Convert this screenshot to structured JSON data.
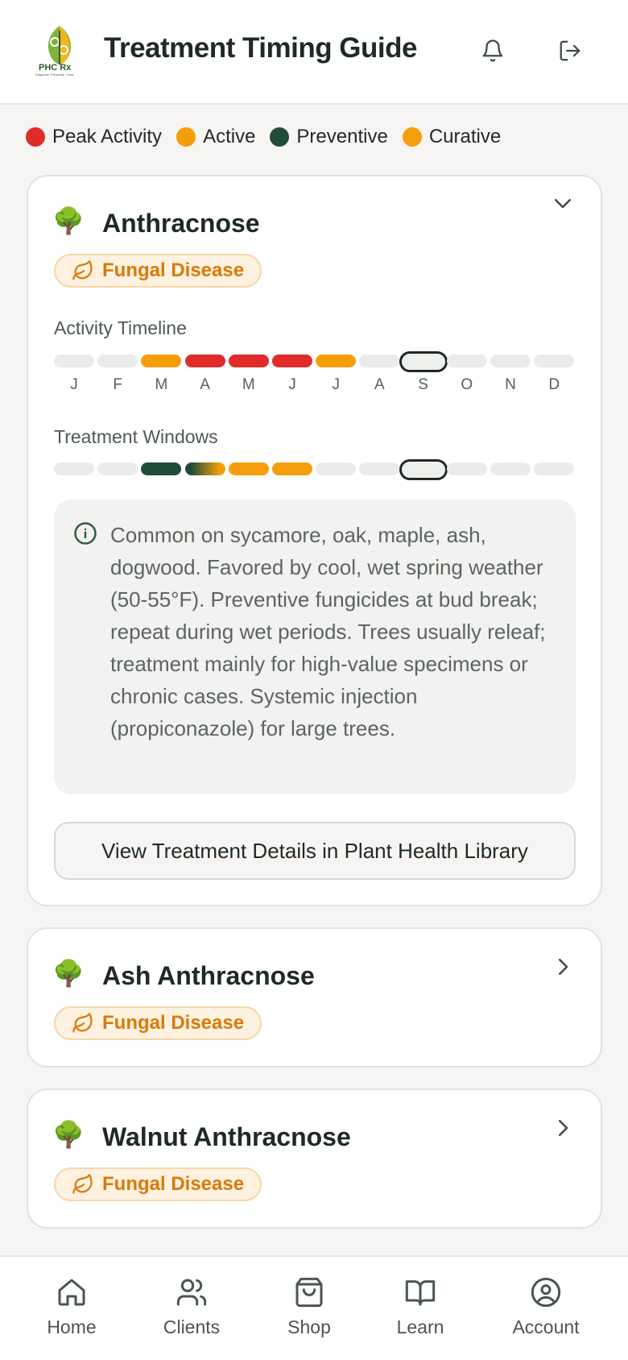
{
  "header": {
    "title": "Treatment Timing Guide",
    "logo_text": "PHC Rx",
    "logo_tagline": "Diagnose. Prescribe. Treat."
  },
  "legend": [
    {
      "label": "Peak Activity",
      "color": "#e02b2b"
    },
    {
      "label": "Active",
      "color": "#f59e0b"
    },
    {
      "label": "Preventive",
      "color": "#1f4d3a"
    },
    {
      "label": "Curative",
      "color": "#f59e0b"
    }
  ],
  "months": [
    "J",
    "F",
    "M",
    "A",
    "M",
    "J",
    "J",
    "A",
    "S",
    "O",
    "N",
    "D"
  ],
  "current_month_index": 8,
  "cards": [
    {
      "icon": "🌳",
      "title": "Anthracnose",
      "category": "Fungal Disease",
      "expanded": true,
      "activity_label": "Activity Timeline",
      "treatment_label": "Treatment Windows",
      "activity": [
        "none",
        "none",
        "active",
        "peak",
        "peak",
        "peak",
        "active",
        "none",
        "none",
        "none",
        "none",
        "none"
      ],
      "treatment": [
        "none",
        "none",
        "preventive",
        "preventive-curative",
        "curative",
        "curative",
        "none",
        "none",
        "none",
        "none",
        "none",
        "none"
      ],
      "note": "Common on sycamore, oak, maple, ash, dogwood. Favored by cool, wet spring weather (50-55°F). Preventive fungicides at bud break; repeat during wet periods. Trees usually releaf; treatment mainly for high-value specimens or chronic cases. Systemic injection (propiconazole) for large trees.",
      "button_label": "View Treatment Details in Plant Health Library"
    },
    {
      "icon": "🌳",
      "title": "Ash Anthracnose",
      "category": "Fungal Disease",
      "expanded": false
    },
    {
      "icon": "🌳",
      "title": "Walnut Anthracnose",
      "category": "Fungal Disease",
      "expanded": false
    }
  ],
  "nav": [
    {
      "label": "Home",
      "icon": "home-icon"
    },
    {
      "label": "Clients",
      "icon": "users-icon"
    },
    {
      "label": "Shop",
      "icon": "shopping-bag-icon"
    },
    {
      "label": "Learn",
      "icon": "book-icon"
    },
    {
      "label": "Account",
      "icon": "user-circle-icon"
    }
  ],
  "colors": {
    "peak": "#e02b2b",
    "active": "#f59e0b",
    "preventive": "#1f4d3a",
    "curative": "#f59e0b",
    "none": "#ebebea"
  }
}
